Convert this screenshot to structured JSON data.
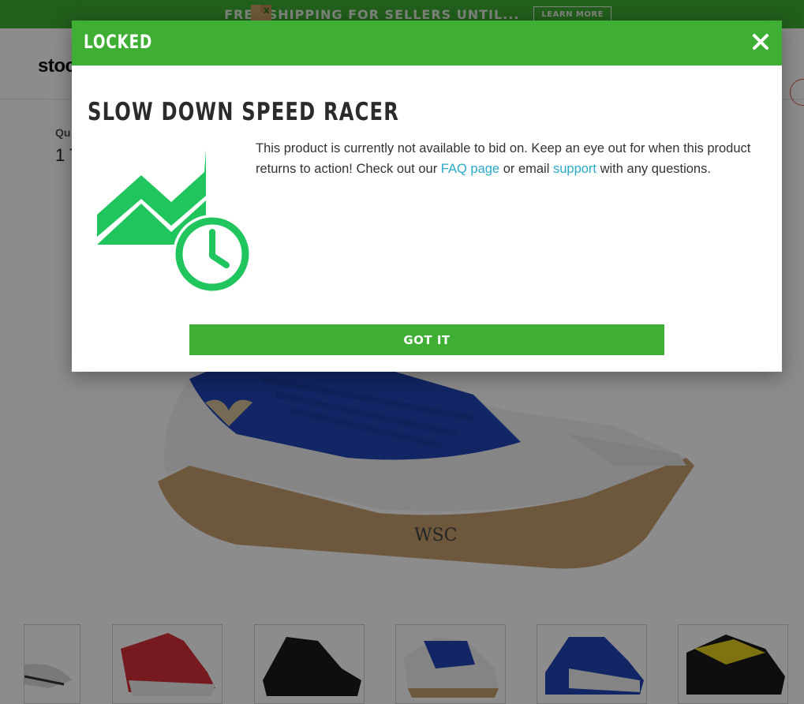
{
  "promo": {
    "text": "FREE SHIPPING FOR SELLERS UNTIL...",
    "button_label": "LEARN MORE"
  },
  "header": {
    "logo_text": "stoc"
  },
  "product": {
    "quantity_label": "Qu",
    "quantity_value": "1 T",
    "thumbnails": [
      "white-sneaker",
      "red-white-sneaker",
      "black-sneaker",
      "blue-white-sneaker",
      "blue-white-sneaker-2",
      "black-yellow-sneaker"
    ],
    "hero_signature": "WSC"
  },
  "modal": {
    "title": "LOCKED",
    "close_icon": "close-icon",
    "headline": "SLOW DOWN SPEED RACER",
    "message_part1": "This product is currently not available to bid on. Keep an eye out for when this product returns to action! Check out our ",
    "faq_link": "FAQ page",
    "message_part2": " or email ",
    "support_link": "support",
    "message_part3": " with any questions.",
    "button_label": "GOT IT",
    "graphic_icon": "chart-clock-icon"
  },
  "colors": {
    "brand_green": "#3fae34",
    "graphic_green": "#21c55d",
    "link": "#2aa9c9"
  }
}
